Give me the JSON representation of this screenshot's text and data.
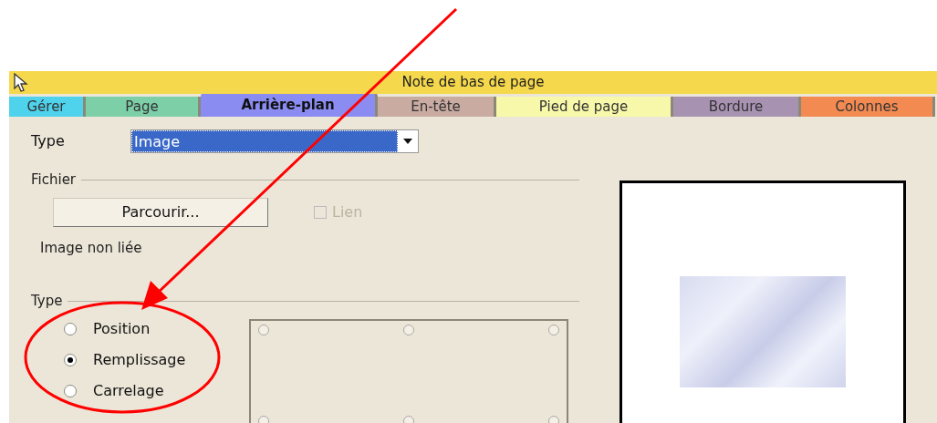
{
  "dialog": {
    "title": "Note de bas de page"
  },
  "tabs": [
    {
      "label": "Gérer",
      "selected": false,
      "color": "#4fd2ec"
    },
    {
      "label": "Page",
      "selected": false,
      "color": "#7dcfa8"
    },
    {
      "label": "Arrière-plan",
      "selected": true,
      "color": "#8a8cf2"
    },
    {
      "label": "En-tête",
      "selected": false,
      "color": "#c9aba2"
    },
    {
      "label": "Pied de page",
      "selected": false,
      "color": "#f8f8aa"
    },
    {
      "label": "Bordure",
      "selected": false,
      "color": "#a892b2"
    },
    {
      "label": "Colonnes",
      "selected": false,
      "color": "#f28a52"
    }
  ],
  "type_field": {
    "label": "Type",
    "value": "Image"
  },
  "file_group": {
    "title": "Fichier",
    "browse_button": "Parcourir...",
    "link_checkbox": {
      "label": "Lien",
      "checked": false,
      "disabled": true
    },
    "status": "Image non liée"
  },
  "type_group": {
    "title": "Type",
    "options": [
      {
        "label": "Position",
        "selected": false
      },
      {
        "label": "Remplissage",
        "selected": true
      },
      {
        "label": "Carrelage",
        "selected": false
      }
    ]
  },
  "position_grid": [
    {
      "selected": false
    },
    {
      "selected": false
    },
    {
      "selected": false
    },
    {
      "selected": false
    },
    {
      "selected": false
    },
    {
      "selected": false
    }
  ]
}
